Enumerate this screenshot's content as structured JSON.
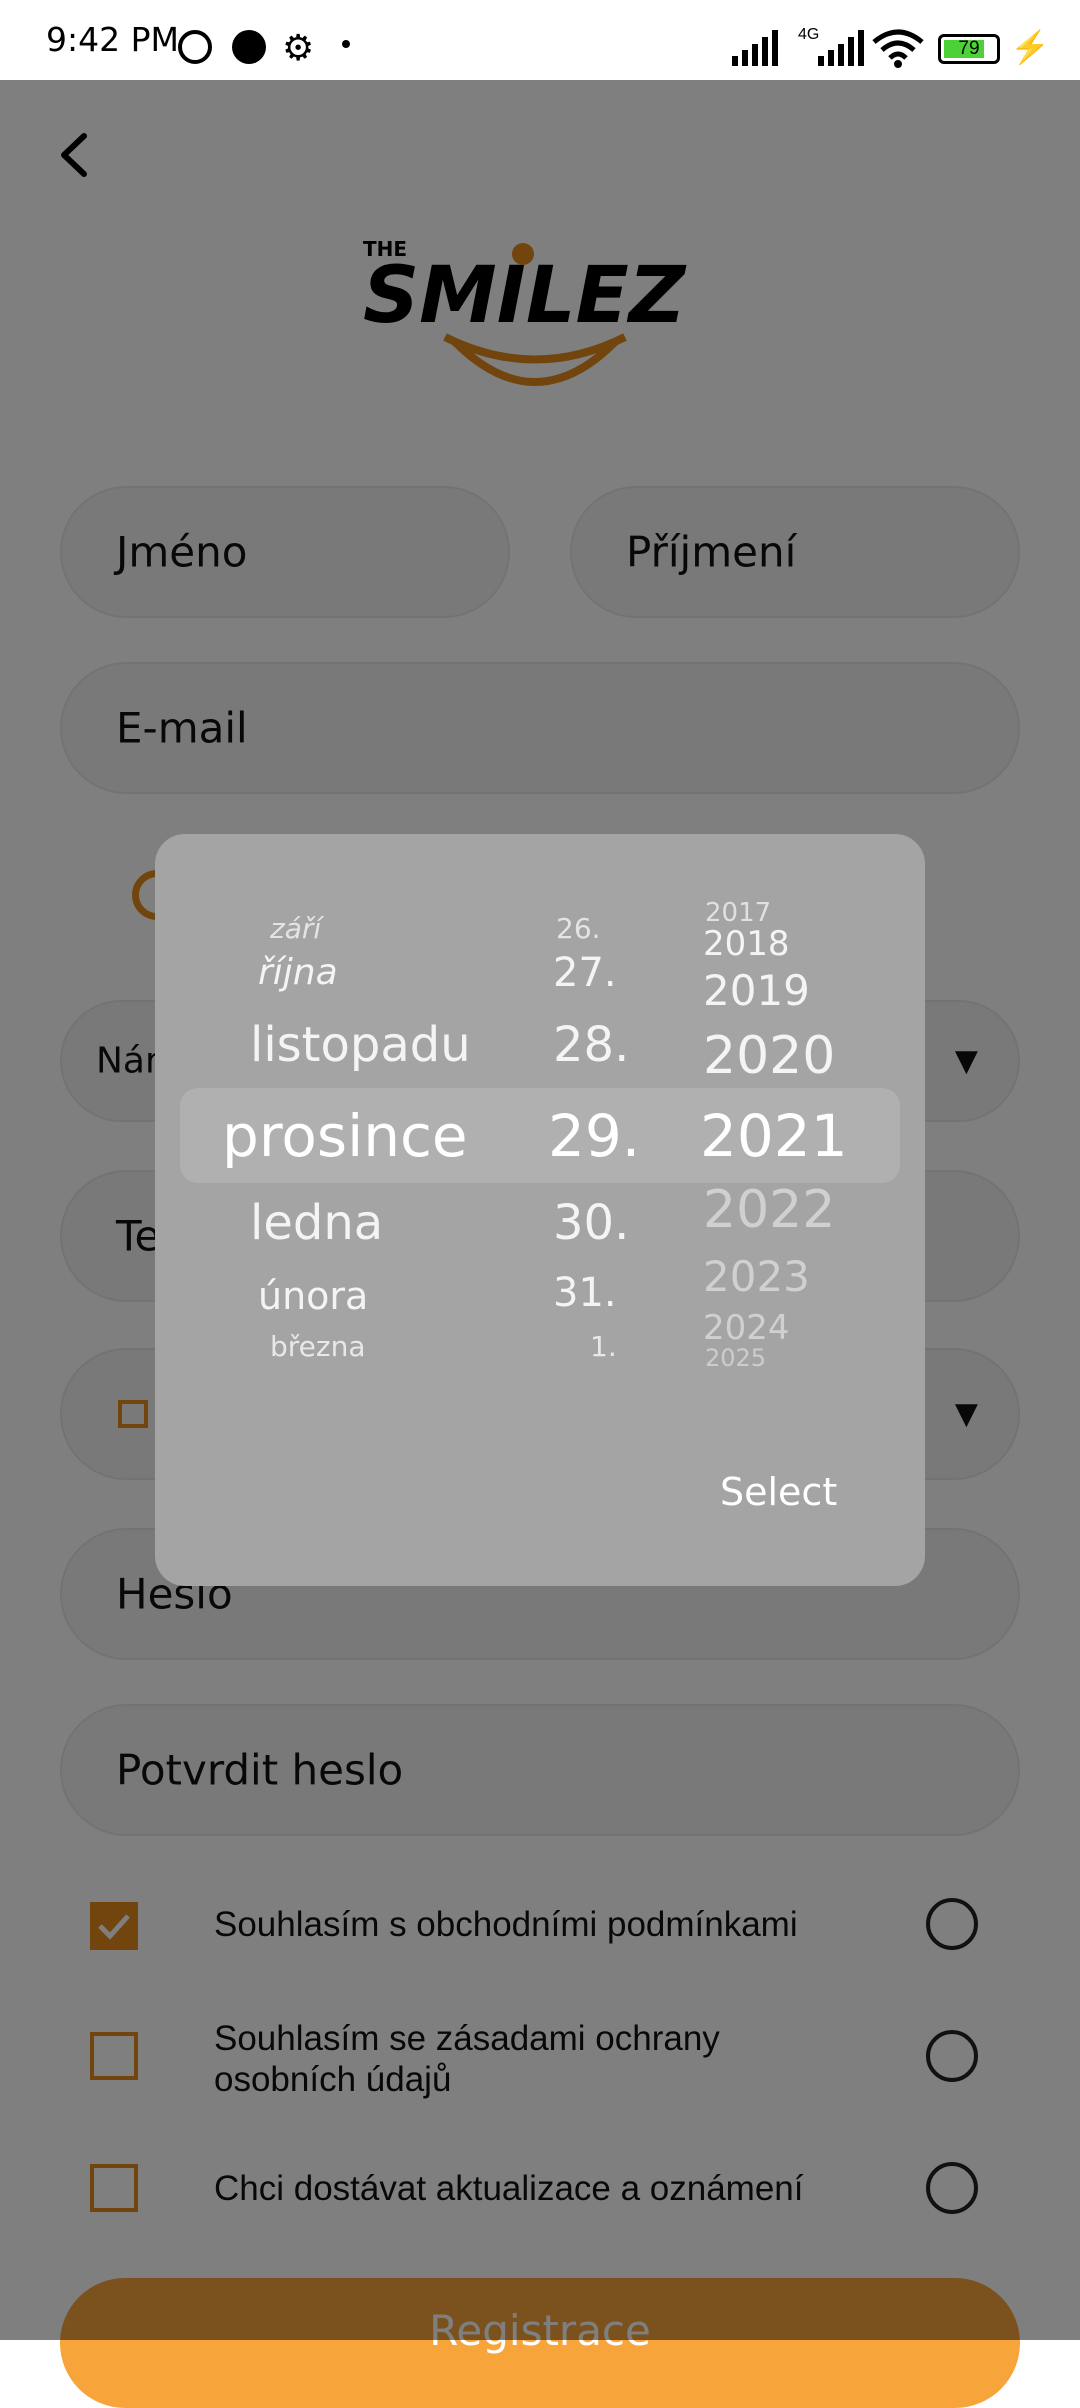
{
  "status": {
    "time": "9:42 PM",
    "battery": "79",
    "network": "4G"
  },
  "form": {
    "first_name": "Jméno",
    "last_name": "Příjmení",
    "email": "E-mail",
    "name_partial": "Nán",
    "phone_partial": "Te",
    "password": "Heslo",
    "confirm_password": "Potvrdit heslo"
  },
  "checkboxes": [
    {
      "label": "Souhlasím s obchodními podmínkami",
      "checked": true
    },
    {
      "label": "Souhlasím se zásadami ochrany osobních údajů",
      "checked": false
    },
    {
      "label": "Chci dostávat aktualizace a oznámení",
      "checked": false
    }
  ],
  "register_button": "Registrace",
  "picker": {
    "months": [
      "září",
      "října",
      "listopadu",
      "prosince",
      "ledna",
      "února",
      "března"
    ],
    "days": [
      "26.",
      "27.",
      "28.",
      "29.",
      "30.",
      "31.",
      "1."
    ],
    "years": [
      "2017",
      "2018",
      "2019",
      "2020",
      "2021",
      "2022",
      "2023",
      "2024",
      "2025"
    ],
    "selected_month": "prosince",
    "selected_day": "29.",
    "selected_year": "2021",
    "select_label": "Select"
  },
  "colors": {
    "accent": "#e58a1c",
    "dialog": "#a4a4a4"
  }
}
